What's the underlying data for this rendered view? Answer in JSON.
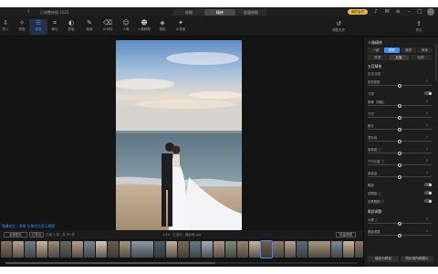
{
  "titlebar": {
    "doc_title": "已调整修图  2025",
    "tabs": [
      "修图",
      "精修",
      "批量修图"
    ],
    "vip_label": "我的会员"
  },
  "toolbar": {
    "tools": [
      "导入",
      "修图",
      "调整",
      "裁切",
      "蒙版",
      "局部",
      "AI消除",
      "人像",
      "人像精修",
      "调色",
      "AI背景"
    ],
    "active_index": 2,
    "right_tools": [
      "调整历史",
      "导出"
    ]
  },
  "canvas": {
    "hint": "隐藏对比 | 原图  长按对比显示原图"
  },
  "stripbar": {
    "left_buttons": [
      "全部图片",
      "已导出"
    ],
    "count_text": "已选 1 张 · 共 39 张",
    "file_info": "1/39 · 已选中 · 婚纱照.jpg",
    "right_button": "批量修图"
  },
  "filmstrip": {
    "thumb_colors": [
      "#8a7462",
      "#b9a48f",
      "#6f7d88",
      "#c9b8a4",
      "#9c8b73",
      "#5f6d5c",
      "#b7a08a",
      "#7a8591",
      "#d6c7b4",
      "#6b5b4c",
      "#a89780",
      "#8d9aa3",
      "#4c5a66",
      "#c2b09a",
      "#7d6a58",
      "#6a7a86",
      "#a3aebb",
      "#b59c84",
      "#7f8c7a",
      "#9a8670",
      "#c8b59f",
      "#6e5e50",
      "#8f7c68",
      "#b4a28e",
      "#5d6b77",
      "#a9967f",
      "#7b8894",
      "#cbb9a3",
      "#8a7866",
      "#9fa9b2"
    ],
    "selected_index": 21
  },
  "panel": {
    "title": "人像精修",
    "segments": [
      "一键",
      "精修",
      "美颜",
      "美体"
    ],
    "active_segment": 1,
    "segments2": [
      "肤质",
      "五官",
      "轮廓"
    ],
    "active_segment2": 1,
    "section_title": "五官精修",
    "section_sub": "脸型调整",
    "items": [
      {
        "label": "脸型瘦脸",
        "value": "0",
        "type": "slider",
        "pos": 0.5
      },
      {
        "label": "下颌",
        "value": "",
        "type": "toggle"
      },
      {
        "label": "颧骨（侧脸）",
        "value": "0",
        "type": "slider",
        "pos": 0.5
      },
      {
        "label": "下巴",
        "value": "0",
        "type": "slider",
        "pos": 0.5
      },
      {
        "label": "额头",
        "value": "0",
        "type": "slider",
        "pos": 0.5
      },
      {
        "label": "发际线",
        "value": "0",
        "type": "slider",
        "pos": 0.5
      },
      {
        "label": "瘦鼻翼 ⓘ",
        "value": "0",
        "type": "slider",
        "pos": 0.5
      },
      {
        "label": "下巴长度 ⓘ",
        "value": "0",
        "type": "slider",
        "pos": 0.5
      },
      {
        "label": "鼻梁高",
        "value": "0",
        "type": "slider",
        "pos": 0.5
      },
      {
        "label": "眼部",
        "value": "",
        "type": "toggle"
      },
      {
        "label": "祛眼袋 ⓘ",
        "value": "",
        "type": "toggle"
      },
      {
        "label": "祛黑眼圈 ⓘ",
        "value": "",
        "type": "toggle"
      }
    ],
    "section2_title": "眼部调整",
    "items2": [
      {
        "label": "大眼 ⓘ",
        "value": "0",
        "type": "slider",
        "pos": 0.5
      },
      {
        "label": "眼距调整",
        "value": "0",
        "type": "slider",
        "pos": 0.5
      }
    ],
    "bottom_buttons": [
      "保存为预设",
      "同步到所有图片"
    ]
  }
}
